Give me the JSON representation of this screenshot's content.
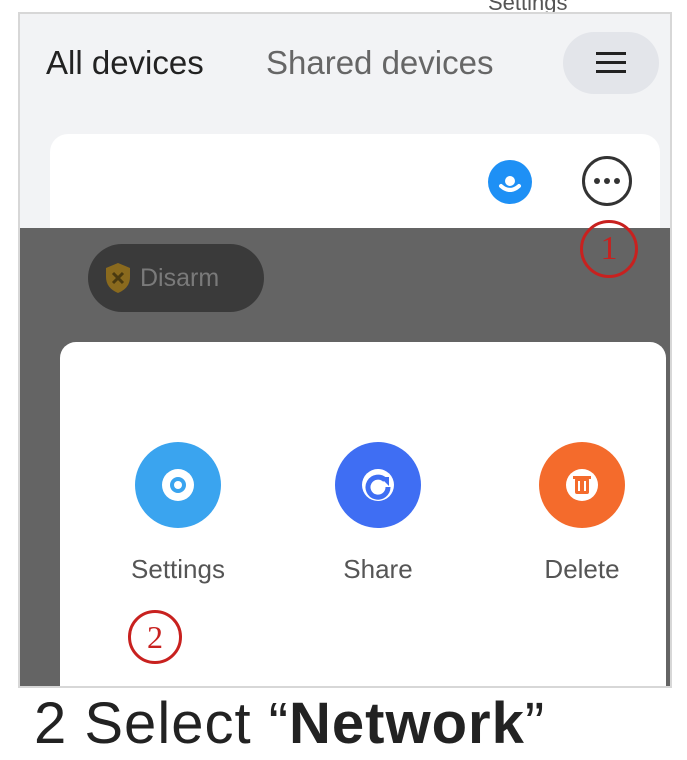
{
  "top_label": "Settings",
  "tabs": {
    "all": "All devices",
    "shared": "Shared devices"
  },
  "badge": {
    "disarm": "Disarm"
  },
  "annotations": {
    "one": "1",
    "two": "2"
  },
  "actions": [
    {
      "label": "Settings",
      "icon": "gear-icon",
      "color": "#3aa4ef"
    },
    {
      "label": "Share",
      "icon": "share-icon",
      "color": "#3f6ef3"
    },
    {
      "label": "Delete",
      "icon": "trash-icon",
      "color": "#f46b2c"
    }
  ],
  "instruction": {
    "prefix": "2 Select",
    "open_quote": "“",
    "keyword": "Network",
    "close_quote": "”"
  }
}
